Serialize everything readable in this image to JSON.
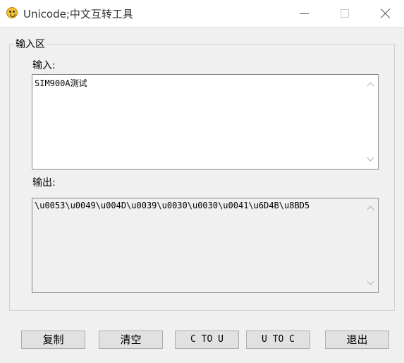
{
  "window": {
    "title": "Unicode;中文互转工具",
    "icon": "smiley-face-icon"
  },
  "group": {
    "legend": "输入区"
  },
  "input": {
    "label": "输入:",
    "value": "SIM900A测试"
  },
  "output": {
    "label": "输出:",
    "value": "\\u0053\\u0049\\u004D\\u0039\\u0030\\u0030\\u0041\\u6D4B\\u8BD5"
  },
  "buttons": {
    "copy": "复制",
    "clear": "清空",
    "c_to_u": "C TO U",
    "u_to_c": "U TO C",
    "exit": "退出"
  }
}
